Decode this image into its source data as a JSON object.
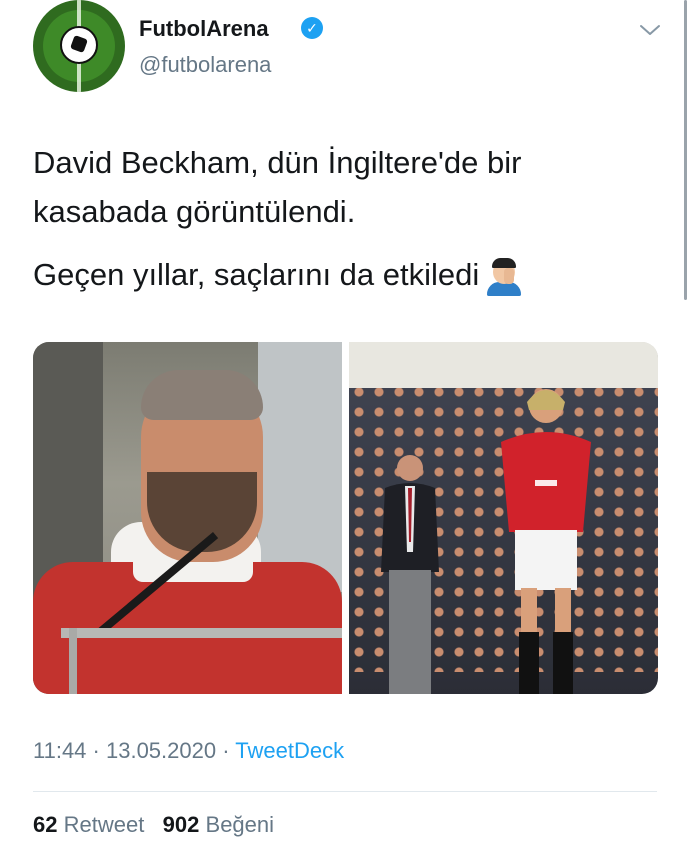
{
  "header": {
    "display_name": "FutbolArena",
    "handle": "@futbolarena",
    "verified_icon": "verified-badge-icon",
    "menu_icon": "chevron-down-icon",
    "avatar_icon": "soccer-ball-avatar-icon"
  },
  "tweet": {
    "line1": "David Beckham, dün İngiltere'de bir kasabada görüntülendi.",
    "line2": "Geçen yıllar, saçlarını da etkiledi",
    "emoji_icon": "man-facepalming-emoji-icon"
  },
  "media": {
    "images": [
      {
        "alt_semantic": "photo-of-man-with-beard"
      },
      {
        "alt_semantic": "photo-of-football-player-on-pitch"
      }
    ]
  },
  "meta": {
    "time": "11:44",
    "sep1": " · ",
    "date": "13.05.2020",
    "sep2": " · ",
    "source": "TweetDeck"
  },
  "stats": {
    "retweets_count": "62",
    "retweets_label": "Retweet",
    "likes_count": "902",
    "likes_label": "Beğeni"
  },
  "colors": {
    "link": "#1da1f2",
    "secondary_text": "#657786",
    "primary_text": "#14171a"
  }
}
